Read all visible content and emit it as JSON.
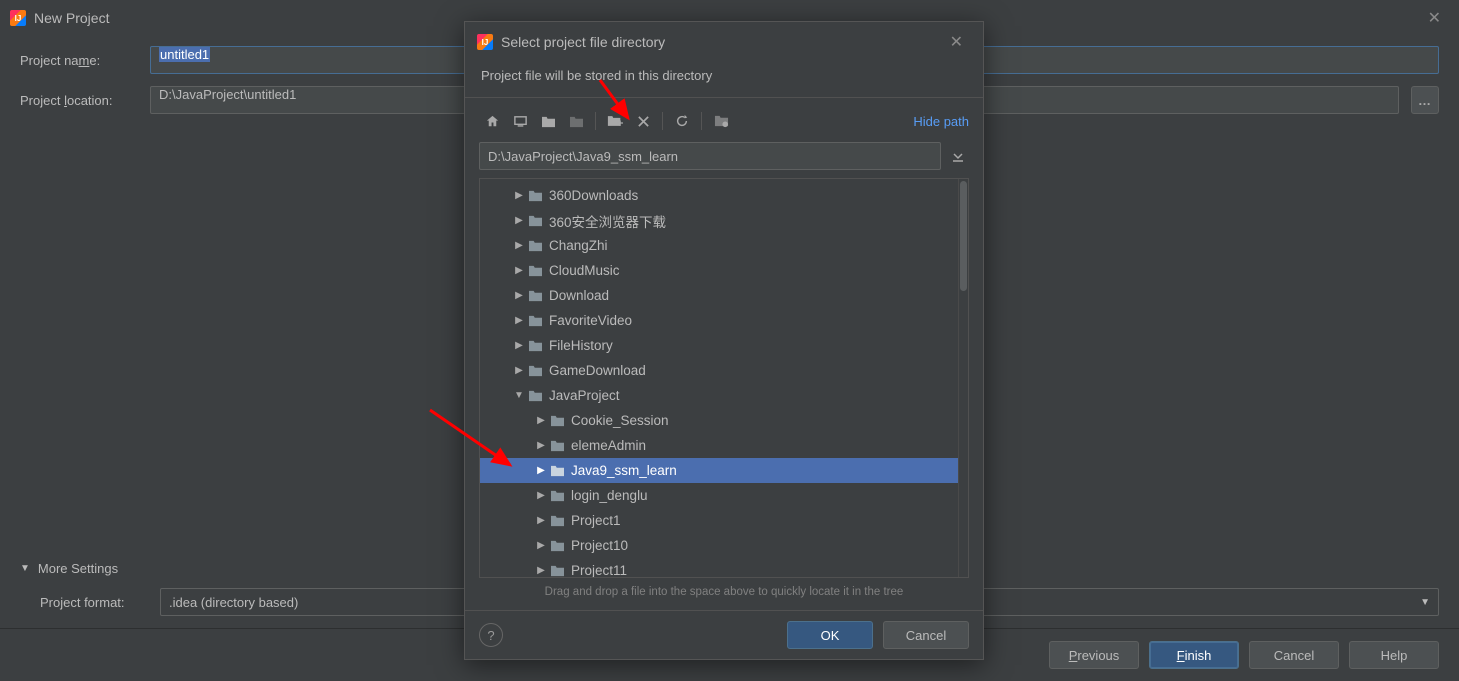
{
  "outer": {
    "title": "New Project",
    "labels": {
      "project_name": "Project name:",
      "project_location": "Project location:",
      "more_settings": "More Settings",
      "project_format": "Project format:"
    },
    "values": {
      "project_name": "untitled1",
      "project_location": "D:\\JavaProject\\untitled1",
      "project_format": ".idea (directory based)"
    },
    "buttons": {
      "previous": "Previous",
      "finish": "Finish",
      "cancel": "Cancel",
      "help": "Help"
    }
  },
  "inner": {
    "title": "Select project file directory",
    "subtitle": "Project file will be stored in this directory",
    "hide_path": "Hide path",
    "path_value": "D:\\JavaProject\\Java9_ssm_learn",
    "drag_hint": "Drag and drop a file into the space above to quickly locate it in the tree",
    "buttons": {
      "ok": "OK",
      "cancel": "Cancel",
      "help": "?"
    },
    "tree": [
      {
        "name": "360Downloads",
        "depth": 1,
        "expanded": false
      },
      {
        "name": "360安全浏览器下载",
        "depth": 1,
        "expanded": false
      },
      {
        "name": "ChangZhi",
        "depth": 1,
        "expanded": false
      },
      {
        "name": "CloudMusic",
        "depth": 1,
        "expanded": false
      },
      {
        "name": "Download",
        "depth": 1,
        "expanded": false
      },
      {
        "name": "FavoriteVideo",
        "depth": 1,
        "expanded": false
      },
      {
        "name": "FileHistory",
        "depth": 1,
        "expanded": false
      },
      {
        "name": "GameDownload",
        "depth": 1,
        "expanded": false
      },
      {
        "name": "JavaProject",
        "depth": 1,
        "expanded": true
      },
      {
        "name": "Cookie_Session",
        "depth": 2,
        "expanded": false
      },
      {
        "name": "elemeAdmin",
        "depth": 2,
        "expanded": false
      },
      {
        "name": "Java9_ssm_learn",
        "depth": 2,
        "expanded": false,
        "selected": true
      },
      {
        "name": "login_denglu",
        "depth": 2,
        "expanded": false
      },
      {
        "name": "Project1",
        "depth": 2,
        "expanded": false
      },
      {
        "name": "Project10",
        "depth": 2,
        "expanded": false
      },
      {
        "name": "Project11",
        "depth": 2,
        "expanded": false
      }
    ]
  }
}
